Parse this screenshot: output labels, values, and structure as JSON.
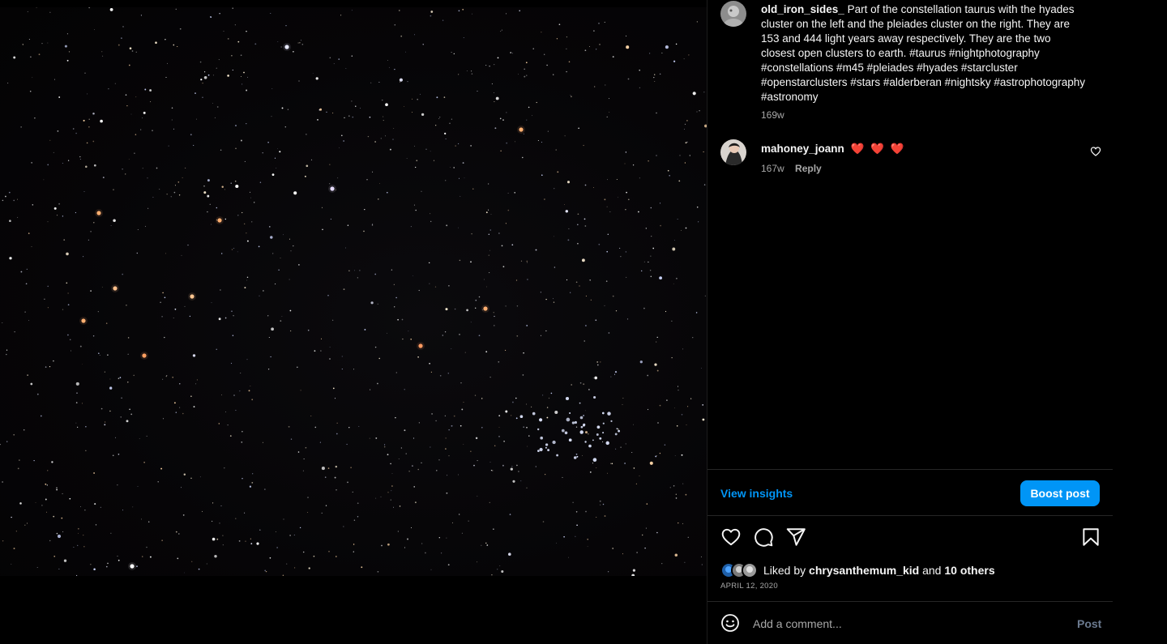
{
  "caption": {
    "username": "old_iron_sides_",
    "text": "Part of the constellation taurus with the hyades cluster on the left and the pleiades cluster on the right. They are 153 and 444 light years away respectively. They are the two closest open clusters to earth. #taurus #nightphotography #constellations #m45 #pleiades #hyades #starcluster #openstarclusters #stars #alderberan #nightsky #astrophotography #astronomy",
    "time": "169w"
  },
  "comments": [
    {
      "username": "mahoney_joann",
      "text": "❤️ ❤️ ❤️",
      "time": "167w",
      "reply_label": "Reply"
    }
  ],
  "insights": {
    "view_label": "View insights",
    "boost_label": "Boost post"
  },
  "likes": {
    "prefix": "Liked by",
    "user": "chrysanthemum_kid",
    "joiner": "and",
    "others": "10 others"
  },
  "post_date": "APRIL 12, 2020",
  "comment_box": {
    "placeholder": "Add a comment...",
    "post_label": "Post"
  },
  "colors": {
    "accent": "#0095f6",
    "heart": "#ff3040",
    "muted": "#a8a8a8"
  },
  "icons": [
    "heart-icon",
    "comment-icon",
    "share-icon",
    "bookmark-icon",
    "emoji-icon"
  ]
}
